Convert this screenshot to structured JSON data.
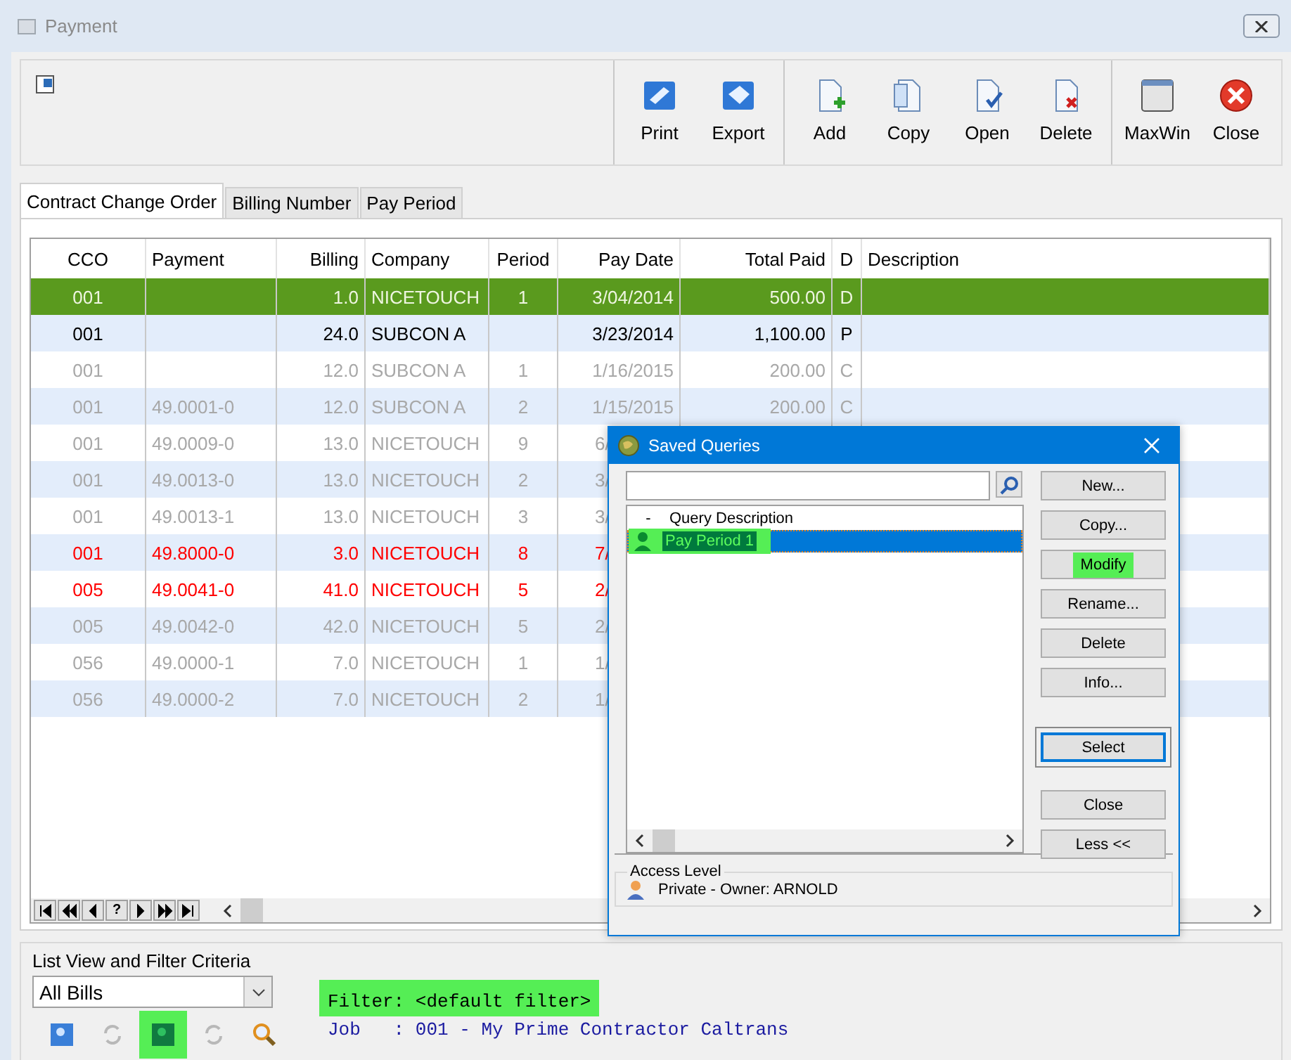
{
  "window": {
    "title": "Payment"
  },
  "toolbar": {
    "groups": [
      [
        {
          "kind": "print",
          "label": "Print"
        },
        {
          "kind": "export",
          "label": "Export"
        }
      ],
      [
        {
          "kind": "add",
          "label": "Add"
        },
        {
          "kind": "copy",
          "label": "Copy"
        },
        {
          "kind": "open",
          "label": "Open"
        },
        {
          "kind": "delete",
          "label": "Delete"
        }
      ],
      [
        {
          "kind": "maxwin",
          "label": "MaxWin"
        },
        {
          "kind": "close",
          "label": "Close"
        }
      ]
    ]
  },
  "tabs": [
    {
      "label": "Contract Change Order",
      "selected": true
    },
    {
      "label": "Billing Number",
      "selected": false
    },
    {
      "label": "Pay Period",
      "selected": false
    }
  ],
  "table": {
    "columns": [
      "CCO",
      "Payment",
      "Billing",
      "Company",
      "Period",
      "Pay Date",
      "Total Paid",
      "D",
      "Description"
    ],
    "rows": [
      {
        "disabled": false,
        "flagged": false,
        "selected": true,
        "cells": [
          "001",
          "",
          "1.0",
          "NICETOUCH",
          "1",
          "3/04/2014",
          "500.00",
          "D",
          ""
        ]
      },
      {
        "disabled": false,
        "flagged": false,
        "selected": false,
        "cells": [
          "001",
          "",
          "24.0",
          "SUBCON A",
          "",
          "3/23/2014",
          "1,100.00",
          "P",
          ""
        ]
      },
      {
        "disabled": true,
        "flagged": false,
        "selected": false,
        "cells": [
          "001",
          "",
          "12.0",
          "SUBCON A",
          "1",
          "1/16/2015",
          "200.00",
          "C",
          ""
        ]
      },
      {
        "disabled": true,
        "flagged": false,
        "selected": false,
        "cells": [
          "001",
          "49.0001-0",
          "12.0",
          "SUBCON A",
          "2",
          "1/15/2015",
          "200.00",
          "C",
          ""
        ]
      },
      {
        "disabled": true,
        "flagged": false,
        "selected": false,
        "cells": [
          "001",
          "49.0009-0",
          "13.0",
          "NICETOUCH",
          "9",
          "6/"
        ]
      },
      {
        "disabled": true,
        "flagged": false,
        "selected": false,
        "cells": [
          "001",
          "49.0013-0",
          "13.0",
          "NICETOUCH",
          "2",
          "3/"
        ]
      },
      {
        "disabled": true,
        "flagged": false,
        "selected": false,
        "cells": [
          "001",
          "49.0013-1",
          "13.0",
          "NICETOUCH",
          "3",
          "3/"
        ]
      },
      {
        "disabled": false,
        "flagged": true,
        "selected": false,
        "cells": [
          "001",
          "49.8000-0",
          "3.0",
          "NICETOUCH",
          "8",
          "7/"
        ]
      },
      {
        "disabled": false,
        "flagged": true,
        "selected": false,
        "cells": [
          "005",
          "49.0041-0",
          "41.0",
          "NICETOUCH",
          "5",
          "2/"
        ]
      },
      {
        "disabled": true,
        "flagged": false,
        "selected": false,
        "cells": [
          "005",
          "49.0042-0",
          "42.0",
          "NICETOUCH",
          "5",
          "2/"
        ]
      },
      {
        "disabled": true,
        "flagged": false,
        "selected": false,
        "cells": [
          "056",
          "49.0000-1",
          "7.0",
          "NICETOUCH",
          "1",
          "1/"
        ]
      },
      {
        "disabled": true,
        "flagged": false,
        "selected": false,
        "cells": [
          "056",
          "49.0000-2",
          "7.0",
          "NICETOUCH",
          "2",
          "1/"
        ]
      }
    ],
    "nav_buttons": [
      {
        "kind": "first"
      },
      {
        "kind": "prev-page"
      },
      {
        "kind": "prev"
      },
      {
        "kind": "help",
        "label": "?"
      },
      {
        "kind": "next"
      },
      {
        "kind": "next-page"
      },
      {
        "kind": "last"
      }
    ]
  },
  "filter_panel": {
    "title": "List View and Filter Criteria",
    "view": "All Bills",
    "tools": [
      {
        "kind": "query",
        "highlighted": false
      },
      {
        "kind": "refresh",
        "highlighted": false
      },
      {
        "kind": "saved",
        "highlighted": true
      },
      {
        "kind": "refresh",
        "highlighted": false
      },
      {
        "kind": "zoom",
        "highlighted": false
      }
    ],
    "filter": {
      "text": "Filter: <default filter>",
      "highlighted": true
    },
    "job": "Job   : 001 - My Prime Contractor Caltrans"
  },
  "dialog": {
    "title": "Saved Queries",
    "list": {
      "header": {
        "marker": "-",
        "label": "Query Description"
      },
      "items": [
        {
          "label": "Pay Period 1",
          "selected": true,
          "highlighted": true
        }
      ]
    },
    "button_groups": [
      [
        {
          "label": "New...",
          "highlighted": false,
          "default": false
        },
        {
          "label": "Copy...",
          "highlighted": false,
          "default": false
        },
        {
          "label": "Modify",
          "highlighted": true,
          "default": false
        },
        {
          "label": "Rename...",
          "highlighted": false,
          "default": false
        },
        {
          "label": "Delete",
          "highlighted": false,
          "default": false
        },
        {
          "label": "Info...",
          "highlighted": false,
          "default": false
        }
      ],
      [
        {
          "label": "Select",
          "highlighted": false,
          "default": true
        }
      ],
      [
        {
          "label": "Close",
          "highlighted": false,
          "default": false
        },
        {
          "label": "Less <<",
          "highlighted": false,
          "default": false
        }
      ]
    ],
    "access": {
      "title": "Access Level",
      "value": "Private - Owner: ARNOLD"
    }
  }
}
